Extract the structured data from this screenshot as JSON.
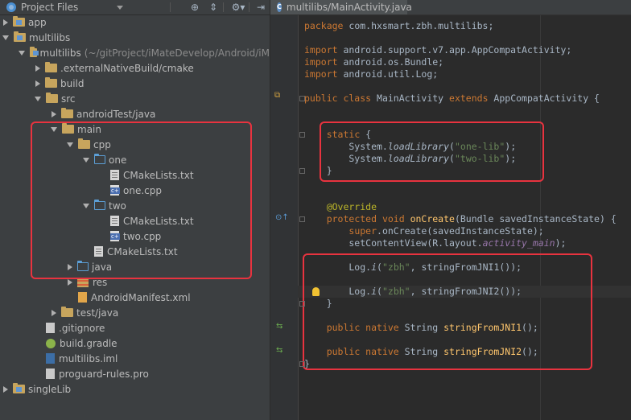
{
  "colors": {
    "highlight_box": "#e8333f",
    "keyword": "#cc7832",
    "string": "#6a8759",
    "annotation": "#bbb529",
    "function": "#ffc66d"
  },
  "project_panel": {
    "title": "Project Files",
    "toolbar_icons": [
      "target-icon",
      "collapse-all-icon",
      "settings-icon",
      "hide-panel-icon"
    ],
    "tree": [
      {
        "label": "app",
        "depth": 0,
        "arrow": "right",
        "icon": "module-folder"
      },
      {
        "label": "multilibs",
        "depth": 0,
        "arrow": "down",
        "icon": "module-folder"
      },
      {
        "label": "multilibs",
        "note": "(~/gitProject/iMateDevelop/Android/iM",
        "depth": 1,
        "arrow": "down",
        "icon": "module-folder"
      },
      {
        "label": ".externalNativeBuild/cmake",
        "depth": 2,
        "arrow": "right",
        "icon": "folder"
      },
      {
        "label": "build",
        "depth": 2,
        "arrow": "right",
        "icon": "folder"
      },
      {
        "label": "src",
        "depth": 2,
        "arrow": "down",
        "icon": "folder"
      },
      {
        "label": "androidTest/java",
        "depth": 3,
        "arrow": "right",
        "icon": "folder"
      },
      {
        "label": "main",
        "depth": 3,
        "arrow": "down",
        "icon": "folder"
      },
      {
        "label": "cpp",
        "depth": 4,
        "arrow": "down",
        "icon": "folder"
      },
      {
        "label": "one",
        "depth": 5,
        "arrow": "down",
        "icon": "source-folder"
      },
      {
        "label": "CMakeLists.txt",
        "depth": 6,
        "arrow": "none",
        "icon": "cmake-file"
      },
      {
        "label": "one.cpp",
        "depth": 6,
        "arrow": "none",
        "icon": "cpp-file"
      },
      {
        "label": "two",
        "depth": 5,
        "arrow": "down",
        "icon": "source-folder"
      },
      {
        "label": "CMakeLists.txt",
        "depth": 6,
        "arrow": "none",
        "icon": "cmake-file"
      },
      {
        "label": "two.cpp",
        "depth": 6,
        "arrow": "none",
        "icon": "cpp-file"
      },
      {
        "label": "CMakeLists.txt",
        "depth": 5,
        "arrow": "none",
        "icon": "cmake-file"
      },
      {
        "label": "java",
        "depth": 4,
        "arrow": "right",
        "icon": "source-folder"
      },
      {
        "label": "res",
        "depth": 4,
        "arrow": "right",
        "icon": "res-folder"
      },
      {
        "label": "AndroidManifest.xml",
        "depth": 4,
        "arrow": "none",
        "icon": "xml-file"
      },
      {
        "label": "test/java",
        "depth": 3,
        "arrow": "right",
        "icon": "folder"
      },
      {
        "label": ".gitignore",
        "depth": 2,
        "arrow": "none",
        "icon": "text-file"
      },
      {
        "label": "build.gradle",
        "depth": 2,
        "arrow": "none",
        "icon": "gradle-file"
      },
      {
        "label": "multilibs.iml",
        "depth": 2,
        "arrow": "none",
        "icon": "iml-file"
      },
      {
        "label": "proguard-rules.pro",
        "depth": 2,
        "arrow": "none",
        "icon": "text-file"
      },
      {
        "label": "singleLib",
        "depth": 0,
        "arrow": "right",
        "icon": "module-folder"
      }
    ]
  },
  "editor": {
    "tab_label": "multilibs/MainActivity.java",
    "tab_icon": "java-class-icon",
    "lines": [
      {
        "i": 0,
        "segs": [
          [
            "kw",
            "package "
          ],
          [
            "",
            "com.hxsmart.zbh.multilibs;"
          ]
        ]
      },
      {
        "i": 2,
        "segs": [
          [
            "kw",
            "import "
          ],
          [
            "",
            "android.support.v7.app.AppCompatActivity;"
          ]
        ]
      },
      {
        "i": 3,
        "segs": [
          [
            "kw",
            "import "
          ],
          [
            "",
            "android.os.Bundle;"
          ]
        ]
      },
      {
        "i": 4,
        "segs": [
          [
            "kw",
            "import "
          ],
          [
            "",
            "android.util.Log;"
          ]
        ]
      },
      {
        "i": 6,
        "segs": [
          [
            "kw",
            "public class "
          ],
          [
            "",
            "MainActivity "
          ],
          [
            "kw",
            "extends "
          ],
          [
            "",
            "AppCompatActivity {"
          ]
        ]
      },
      {
        "i": 9,
        "segs": [
          [
            "",
            "    "
          ],
          [
            "kw",
            "static "
          ],
          [
            "",
            "{"
          ]
        ]
      },
      {
        "i": 10,
        "segs": [
          [
            "",
            "        System."
          ],
          [
            "it",
            "loadLibrary"
          ],
          [
            "",
            "("
          ],
          [
            "str",
            "\"one-lib\""
          ],
          [
            "",
            ");"
          ]
        ]
      },
      {
        "i": 11,
        "segs": [
          [
            "",
            "        System."
          ],
          [
            "it",
            "loadLibrary"
          ],
          [
            "",
            "("
          ],
          [
            "str",
            "\"two-lib\""
          ],
          [
            "",
            ");"
          ]
        ]
      },
      {
        "i": 12,
        "segs": [
          [
            "",
            "    }"
          ]
        ]
      },
      {
        "i": 15,
        "segs": [
          [
            "ann",
            "    @Override"
          ]
        ]
      },
      {
        "i": 16,
        "segs": [
          [
            "",
            "    "
          ],
          [
            "kw",
            "protected void "
          ],
          [
            "fn",
            "onCreate"
          ],
          [
            "",
            "(Bundle savedInstanceState) {"
          ]
        ]
      },
      {
        "i": 17,
        "segs": [
          [
            "",
            "        "
          ],
          [
            "kw",
            "super"
          ],
          [
            "",
            ".onCreate(savedInstanceState);"
          ]
        ]
      },
      {
        "i": 18,
        "segs": [
          [
            "",
            "        setContentView(R.layout."
          ],
          [
            "itp",
            "activity_main"
          ],
          [
            "",
            ");"
          ]
        ]
      },
      {
        "i": 20,
        "segs": [
          [
            "",
            "        Log."
          ],
          [
            "it",
            "i"
          ],
          [
            "",
            "("
          ],
          [
            "str",
            "\"zbh\""
          ],
          [
            "",
            ", stringFromJNI1());"
          ]
        ]
      },
      {
        "i": 22,
        "segs": [
          [
            "",
            "        Log."
          ],
          [
            "it",
            "i"
          ],
          [
            "",
            "("
          ],
          [
            "str",
            "\"zbh\""
          ],
          [
            "",
            ", stringFromJNI2());"
          ]
        ]
      },
      {
        "i": 23,
        "segs": [
          [
            "",
            "    }"
          ]
        ]
      },
      {
        "i": 25,
        "segs": [
          [
            "",
            "    "
          ],
          [
            "kw",
            "public native "
          ],
          [
            "",
            "String "
          ],
          [
            "fn",
            "stringFromJNI1"
          ],
          [
            "",
            "();"
          ]
        ]
      },
      {
        "i": 27,
        "segs": [
          [
            "",
            "    "
          ],
          [
            "kw",
            "public native "
          ],
          [
            "",
            "String "
          ],
          [
            "fn",
            "stringFromJNI2"
          ],
          [
            "",
            "();"
          ]
        ]
      },
      {
        "i": 28,
        "segs": [
          [
            "",
            "}"
          ]
        ]
      }
    ],
    "gutter_icons": [
      "implements-marker-icon",
      "override-marker-icon",
      "native-method-icon",
      "native-method-icon",
      "lightbulb-icon"
    ]
  }
}
